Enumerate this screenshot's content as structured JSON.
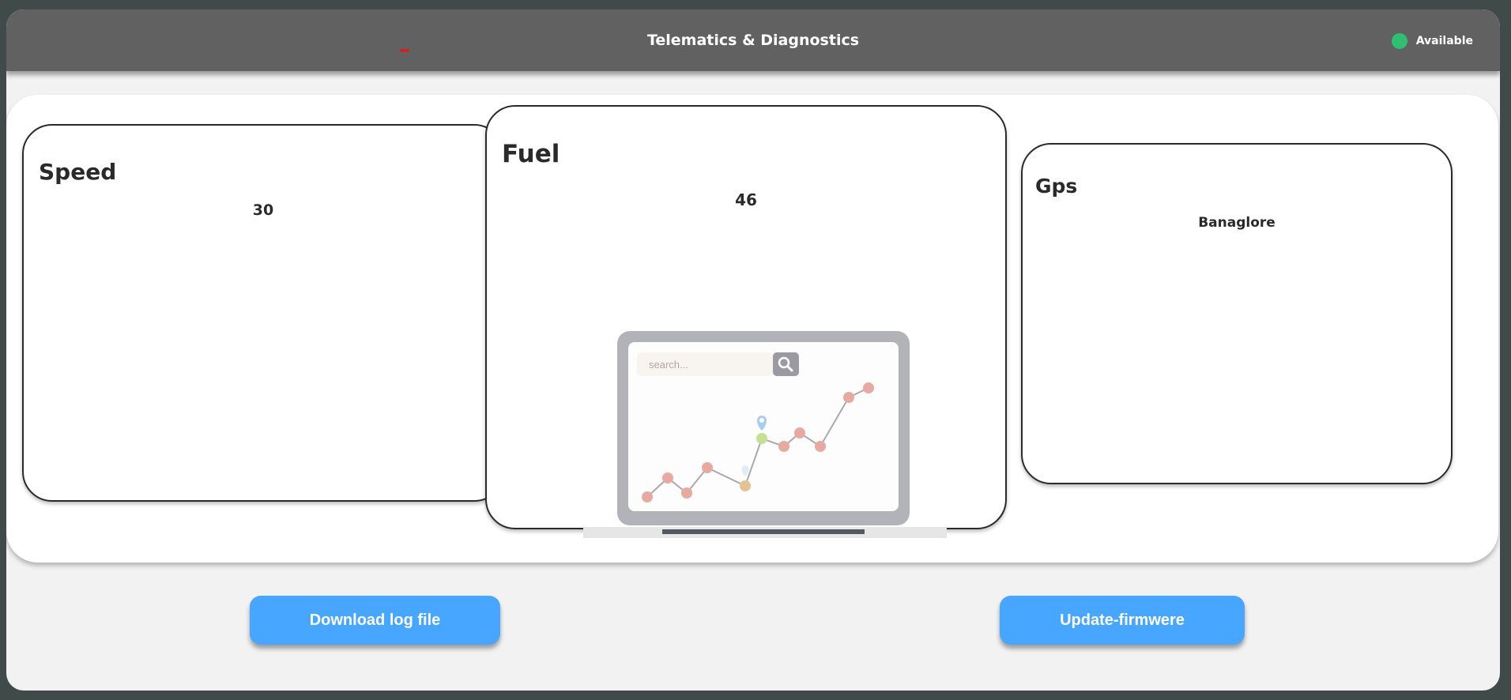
{
  "header": {
    "title": "Telematics & Diagnostics",
    "status_label": "Available",
    "status_color": "#2fbf71",
    "accent_mark_color": "#d42020"
  },
  "cards": {
    "speed": {
      "title": "Speed",
      "value": "30"
    },
    "fuel": {
      "title": "Fuel",
      "value": "46"
    },
    "gps": {
      "title": "Gps",
      "value": "Banaglore"
    }
  },
  "illustration": {
    "search_placeholder": "search...",
    "icons": [
      "laptop-icon",
      "search-icon",
      "map-pin-icon"
    ]
  },
  "actions": {
    "download_label": "Download log file",
    "update_label": "Update-firmwere",
    "button_color": "#47a6ff"
  }
}
